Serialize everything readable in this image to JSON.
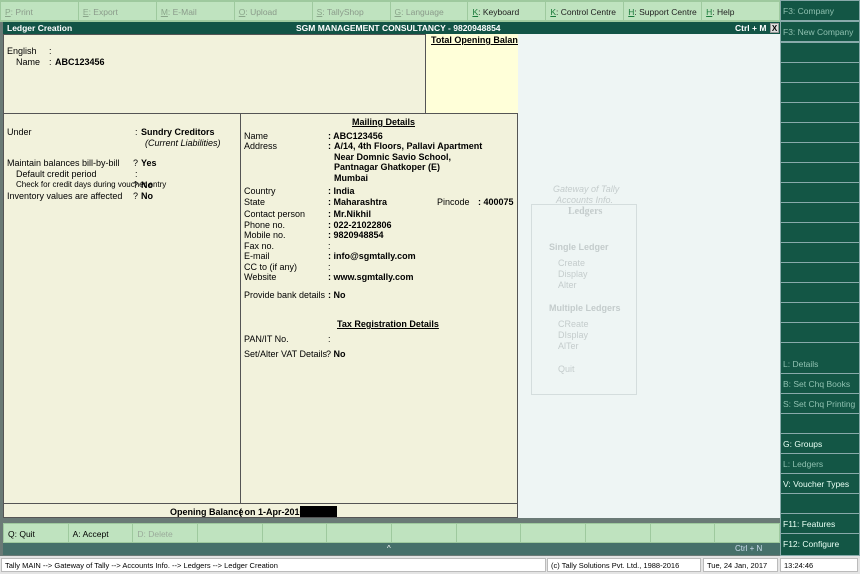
{
  "top_buttons": [
    {
      "key": "P",
      "label": ": Print",
      "enabled": false
    },
    {
      "key": "E",
      "label": ": Export",
      "enabled": false
    },
    {
      "key": "M",
      "label": ": E-Mail",
      "enabled": false
    },
    {
      "key": "O",
      "label": ": Upload",
      "enabled": false
    },
    {
      "key": "S",
      "label": ": TallyShop",
      "enabled": false
    },
    {
      "key": "G",
      "label": ": Language",
      "enabled": false
    },
    {
      "key": "K",
      "label": ": Keyboard",
      "enabled": true
    },
    {
      "key": "K",
      "label": ": Control Centre",
      "enabled": true
    },
    {
      "key": "H",
      "label": ": Support Centre",
      "enabled": true
    },
    {
      "key": "H",
      "label": ": Help",
      "enabled": true
    }
  ],
  "title": {
    "left": "Ledger Creation",
    "center": "SGM MANAGEMENT CONSULTANCY - 9820948854",
    "shortcut": "Ctrl + M",
    "close": "X"
  },
  "header": {
    "english_label": "English",
    "name_label": "Name",
    "name_value": "ABC123456",
    "total_opening_balance": "Total Opening Balance"
  },
  "left": {
    "under_label": "Under",
    "under_value": "Sundry Creditors",
    "under_sub": "(Current Liabilities)",
    "bill_label": "Maintain balances bill-by-bill",
    "bill_value": "Yes",
    "credit_label": "Default credit period",
    "check_label": "Check for credit days during voucher entry",
    "check_value": "No",
    "inv_label": "Inventory values are affected",
    "inv_value": "No"
  },
  "mailing": {
    "heading": "Mailing Details",
    "name_label": "Name",
    "name": "ABC123456",
    "address_label": "Address",
    "address": [
      "A/14, 4th Floors, Pallavi Apartment",
      "Near Domnic Savio School,",
      "Pantnagar Ghatkoper (E)",
      "Mumbai"
    ],
    "country_label": "Country",
    "country": "India",
    "state_label": "State",
    "state": "Maharashtra",
    "pincode_label": "Pincode",
    "pincode": "400075",
    "contact_label": "Contact person",
    "contact": "Mr.Nikhil",
    "phone_label": "Phone no.",
    "phone": "022-21022806",
    "mobile_label": "Mobile no.",
    "mobile": "9820948854",
    "fax_label": "Fax no.",
    "email_label": "E-mail",
    "email": "info@sgmtally.com",
    "cc_label": "CC to (if any)",
    "website_label": "Website",
    "website": "www.sgmtally.com",
    "bank_label": "Provide bank details",
    "bank": "No"
  },
  "tax": {
    "heading": "Tax Registration Details",
    "pan_label": "PAN/IT No.",
    "vat_label": "Set/Alter VAT Details",
    "vat": "No"
  },
  "opening": {
    "label": "Opening Balance",
    "date": "( on 1-Apr-2016) :"
  },
  "ghost_menu": {
    "crumb1": "Gateway of Tally",
    "crumb2": "Accounts Info.",
    "title": "Ledgers",
    "single": "Single Ledger",
    "s_items": [
      "Create",
      "Display",
      "Alter"
    ],
    "multiple": "Multiple Ledgers",
    "m_items": [
      "CReate",
      "DIsplay",
      "AlTer"
    ],
    "quit": "Quit"
  },
  "side_buttons": [
    {
      "label": "F3: Company",
      "enabled": false
    },
    {
      "label": "F3: New Company",
      "enabled": false
    },
    {
      "label": "L: Details",
      "enabled": false
    },
    {
      "label": "B: Set Chq Books",
      "enabled": false
    },
    {
      "label": "S: Set Chq Printing",
      "enabled": false
    },
    {
      "label": "G: Groups",
      "enabled": true
    },
    {
      "label": "L: Ledgers",
      "enabled": false
    },
    {
      "label": "V: Voucher Types",
      "enabled": true
    },
    {
      "label": "F11: Features",
      "enabled": true
    },
    {
      "label": "F12: Configure",
      "enabled": true
    }
  ],
  "bottom_buttons": [
    {
      "label": "Q: Quit"
    },
    {
      "label": "A: Accept"
    },
    {
      "label": "D: Delete"
    }
  ],
  "ctrl_n": {
    "caret": "^",
    "label": "Ctrl + N"
  },
  "status": {
    "path": "Tally MAIN --> Gateway of Tally --> Accounts Info. --> Ledgers --> Ledger Creation",
    "copyright": "(c) Tally Solutions Pvt. Ltd., 1988-2016",
    "date": "Tue, 24 Jan, 2017",
    "time": "13:24:46"
  }
}
